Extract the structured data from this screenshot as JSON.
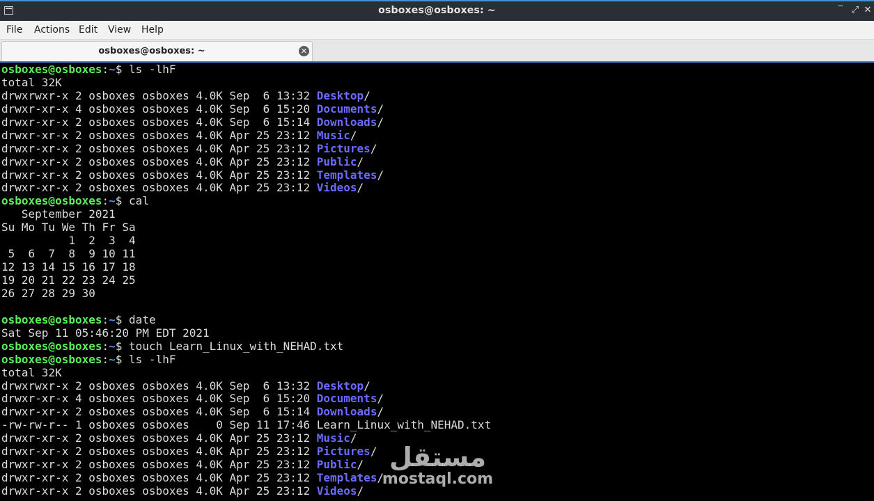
{
  "window": {
    "title": "osboxes@osboxes: ~",
    "controls": [
      "‾",
      "⤢",
      "✕"
    ]
  },
  "menu": [
    "File",
    "Actions",
    "Edit",
    "View",
    "Help"
  ],
  "tab": {
    "label": "osboxes@osboxes: ~",
    "close": "✕"
  },
  "prompt": {
    "userhost": "osboxes@osboxes",
    "sep": ":",
    "path": "~",
    "sign": "$ "
  },
  "terminal": {
    "lines": [
      {
        "type": "prompt",
        "cmd": "ls -lhF"
      },
      {
        "type": "text",
        "text": "total 32K"
      },
      {
        "type": "ls",
        "prefix": "drwxrwxr-x 2 osboxes osboxes 4.0K Sep  6 13:32 ",
        "name": "Desktop",
        "suffix": "/"
      },
      {
        "type": "ls",
        "prefix": "drwxr-xr-x 4 osboxes osboxes 4.0K Sep  6 15:20 ",
        "name": "Documents",
        "suffix": "/"
      },
      {
        "type": "ls",
        "prefix": "drwxr-xr-x 2 osboxes osboxes 4.0K Sep  6 15:14 ",
        "name": "Downloads",
        "suffix": "/"
      },
      {
        "type": "ls",
        "prefix": "drwxr-xr-x 2 osboxes osboxes 4.0K Apr 25 23:12 ",
        "name": "Music",
        "suffix": "/"
      },
      {
        "type": "ls",
        "prefix": "drwxr-xr-x 2 osboxes osboxes 4.0K Apr 25 23:12 ",
        "name": "Pictures",
        "suffix": "/"
      },
      {
        "type": "ls",
        "prefix": "drwxr-xr-x 2 osboxes osboxes 4.0K Apr 25 23:12 ",
        "name": "Public",
        "suffix": "/"
      },
      {
        "type": "ls",
        "prefix": "drwxr-xr-x 2 osboxes osboxes 4.0K Apr 25 23:12 ",
        "name": "Templates",
        "suffix": "/"
      },
      {
        "type": "ls",
        "prefix": "drwxr-xr-x 2 osboxes osboxes 4.0K Apr 25 23:12 ",
        "name": "Videos",
        "suffix": "/"
      },
      {
        "type": "prompt",
        "cmd": "cal"
      },
      {
        "type": "text",
        "text": "   September 2021"
      },
      {
        "type": "text",
        "text": "Su Mo Tu We Th Fr Sa"
      },
      {
        "type": "text",
        "text": "          1  2  3  4"
      },
      {
        "type": "text",
        "text": " 5  6  7  8  9 10 11"
      },
      {
        "type": "text",
        "text": "12 13 14 15 16 17 18"
      },
      {
        "type": "text",
        "text": "19 20 21 22 23 24 25"
      },
      {
        "type": "text",
        "text": "26 27 28 29 30"
      },
      {
        "type": "text",
        "text": ""
      },
      {
        "type": "prompt",
        "cmd": "date"
      },
      {
        "type": "text",
        "text": "Sat Sep 11 05:46:20 PM EDT 2021"
      },
      {
        "type": "prompt",
        "cmd": "touch Learn_Linux_with_NEHAD.txt"
      },
      {
        "type": "prompt",
        "cmd": "ls -lhF"
      },
      {
        "type": "text",
        "text": "total 32K"
      },
      {
        "type": "ls",
        "prefix": "drwxrwxr-x 2 osboxes osboxes 4.0K Sep  6 13:32 ",
        "name": "Desktop",
        "suffix": "/"
      },
      {
        "type": "ls",
        "prefix": "drwxr-xr-x 4 osboxes osboxes 4.0K Sep  6 15:20 ",
        "name": "Documents",
        "suffix": "/"
      },
      {
        "type": "ls",
        "prefix": "drwxr-xr-x 2 osboxes osboxes 4.0K Sep  6 15:14 ",
        "name": "Downloads",
        "suffix": "/"
      },
      {
        "type": "text",
        "text": "-rw-rw-r-- 1 osboxes osboxes    0 Sep 11 17:46 Learn_Linux_with_NEHAD.txt"
      },
      {
        "type": "ls",
        "prefix": "drwxr-xr-x 2 osboxes osboxes 4.0K Apr 25 23:12 ",
        "name": "Music",
        "suffix": "/"
      },
      {
        "type": "ls",
        "prefix": "drwxr-xr-x 2 osboxes osboxes 4.0K Apr 25 23:12 ",
        "name": "Pictures",
        "suffix": "/"
      },
      {
        "type": "ls",
        "prefix": "drwxr-xr-x 2 osboxes osboxes 4.0K Apr 25 23:12 ",
        "name": "Public",
        "suffix": "/"
      },
      {
        "type": "ls",
        "prefix": "drwxr-xr-x 2 osboxes osboxes 4.0K Apr 25 23:12 ",
        "name": "Templates",
        "suffix": "/"
      },
      {
        "type": "ls",
        "prefix": "drwxr-xr-x 2 osboxes osboxes 4.0K Apr 25 23:12 ",
        "name": "Videos",
        "suffix": "/"
      }
    ]
  },
  "watermark": {
    "arabic": "مستقل",
    "latin": "mostaql.com"
  },
  "colors": {
    "prompt_userhost": "#5af05a",
    "prompt_path": "#5a8ff0",
    "directory": "#6b6bff",
    "terminal_bg": "#000000",
    "terminal_fg": "#dcdcdc"
  }
}
